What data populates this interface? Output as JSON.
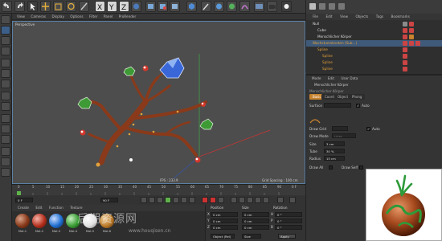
{
  "top_toolbar": {
    "icons": [
      "undo-icon",
      "redo-icon",
      "select-live-icon",
      "move-icon",
      "scale-icon",
      "rotate-icon",
      "x-axis-icon",
      "y-axis-icon",
      "z-axis-icon",
      "world-icon",
      "render-view-icon",
      "render-picture-icon",
      "render-settings-icon",
      "cube-icon",
      "pen-icon",
      "subdivision-icon",
      "array-icon",
      "deformer-icon",
      "floor-icon",
      "camera-icon",
      "light-icon"
    ],
    "axis_labels": [
      "X",
      "Y",
      "Z"
    ]
  },
  "viewport": {
    "menu": [
      "View",
      "Cameras",
      "Display",
      "Options",
      "Filter",
      "Panel",
      "ProRender"
    ],
    "title": "Perspective",
    "fps": "FPS : 233.9",
    "grid_spacing": "Grid Spacing : 100 cm"
  },
  "timeline": {
    "ticks": [
      "0",
      "5",
      "10",
      "15",
      "20",
      "25",
      "30",
      "35",
      "40",
      "45",
      "50",
      "55",
      "60",
      "65",
      "70",
      "75",
      "80",
      "85",
      "90",
      "0 F"
    ],
    "current_frame": "0 F",
    "start_field": "0 F",
    "end_field": "90 F",
    "max_field": "90 F"
  },
  "material_manager": {
    "menu": [
      "Create",
      "Edit",
      "Function",
      "Texture"
    ],
    "materials": [
      {
        "label": "Mat.1",
        "color": "#8a3a1a"
      },
      {
        "label": "Mat.2",
        "color": "#b5301e"
      },
      {
        "label": "Mat.3",
        "color": "#1f6fd0"
      },
      {
        "label": "Mat.4",
        "color": "#3a9c35"
      },
      {
        "label": "Mat.5",
        "color": "#e0e0e0"
      },
      {
        "label": "Mat.6",
        "color": "#bb7a2a"
      }
    ]
  },
  "coordinates": {
    "headers": {
      "position": "Position",
      "size": "Size",
      "rotation": "Rotation"
    },
    "rows": [
      {
        "axis": "X",
        "pos": "0 cm",
        "size": "0 cm",
        "rot_axis": "H",
        "rot": "0 °"
      },
      {
        "axis": "Y",
        "pos": "0 cm",
        "size": "0 cm",
        "rot_axis": "P",
        "rot": "0 °"
      },
      {
        "axis": "Z",
        "pos": "0 cm",
        "size": "0 cm",
        "rot_axis": "B",
        "rot": "0 °"
      }
    ],
    "mode": "Object (Rel)",
    "size_mode": "Size",
    "apply_label": "Apply"
  },
  "object_manager": {
    "menu": [
      "File",
      "Edit",
      "View",
      "Objects",
      "Tags",
      "Bookmarks"
    ],
    "objects": [
      {
        "name": "Null",
        "indent": 0,
        "color": "#d8d8d8",
        "tags": [
          "#8b8b8b",
          "#c44"
        ]
      },
      {
        "name": "Cube",
        "indent": 1,
        "color": "#d8d8d8",
        "tags": [
          "#c44",
          "#c44"
        ]
      },
      {
        "name": "Menschlicher Körper",
        "indent": 1,
        "color": "#d8d8d8",
        "tags": [
          "#c44",
          "#c44"
        ]
      },
      {
        "name": "Wachstumsknoten (Sub...)",
        "indent": 0,
        "color": "#e3a13a",
        "tags": [
          "#c44",
          "#c44",
          "#c44"
        ]
      },
      {
        "name": "Spline",
        "indent": 1,
        "color": "#e3a13a",
        "tags": [
          "#c44"
        ]
      },
      {
        "name": "Spline",
        "indent": 2,
        "color": "#e3a13a",
        "tags": [
          "#c44"
        ]
      },
      {
        "name": "Spline",
        "indent": 2,
        "color": "#e3a13a",
        "tags": [
          "#c44"
        ]
      },
      {
        "name": "Spline",
        "indent": 2,
        "color": "#e3a13a",
        "tags": [
          "#c44"
        ]
      }
    ]
  },
  "attribute_manager": {
    "menu": [
      "Mode",
      "Edit",
      "User Data"
    ],
    "object_title": "Menschlicher Körper",
    "section_title": "Menschlicher Körper",
    "tabs": [
      "Basic",
      "Coord.",
      "Object",
      "Phong"
    ],
    "active_tab": "Basic",
    "surface_label": "Surface",
    "auto_label": "Auto",
    "fields": [
      {
        "label": "Draw Grid",
        "value": "",
        "check": "✓",
        "extra": "Auto"
      },
      {
        "label": "Draw Mode",
        "value": "Lines"
      },
      {
        "label": "Size",
        "value": "3 cm"
      },
      {
        "label": "Tube",
        "value": "30 %"
      },
      {
        "label": "Radius",
        "value": "15 cm"
      },
      {
        "label": "Draw All",
        "value": "",
        "extra": "Draw Self"
      }
    ]
  },
  "watermark": {
    "text": "后期资源网",
    "url": "www.houqisen.cn"
  },
  "colors": {
    "branch": "#8a3a1a",
    "accent": "#c7832e",
    "selection": "#405a7a"
  }
}
